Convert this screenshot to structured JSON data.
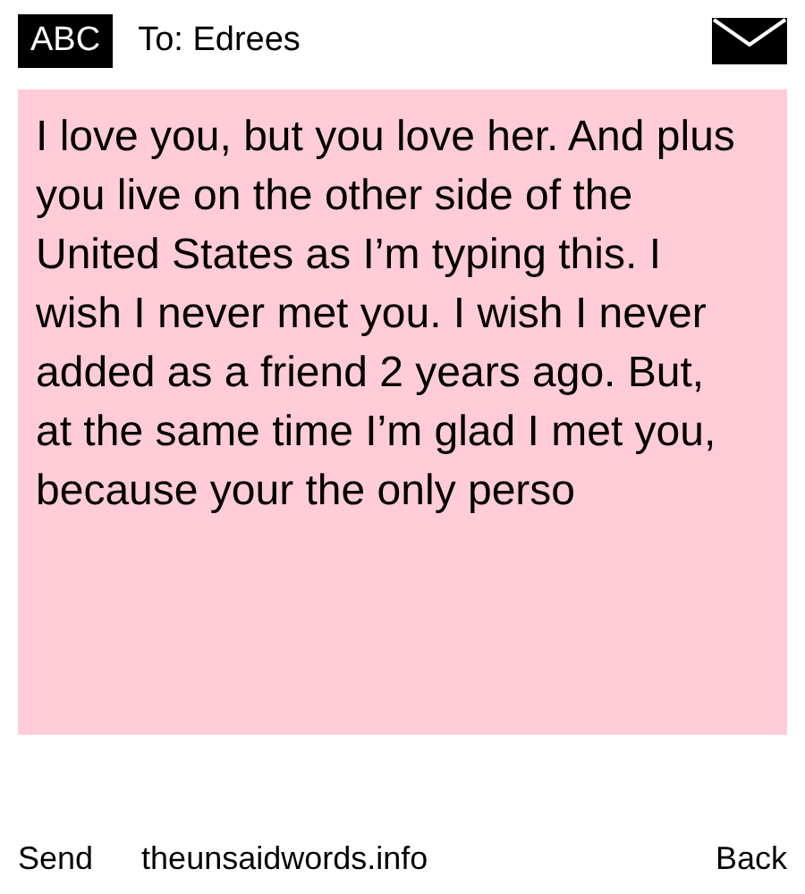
{
  "header": {
    "mode": "ABC",
    "recipient": "To: Edrees"
  },
  "message": "I love you, but you love her. And plus you live on the other side of the United States as I’m typing this. I wish I never met you. I wish I never added as a friend 2 years ago. But, at the same time I’m glad I met you, because your the only perso",
  "softkeys": {
    "left": "Send",
    "center": "theunsaidwords.info",
    "right": "Back"
  }
}
